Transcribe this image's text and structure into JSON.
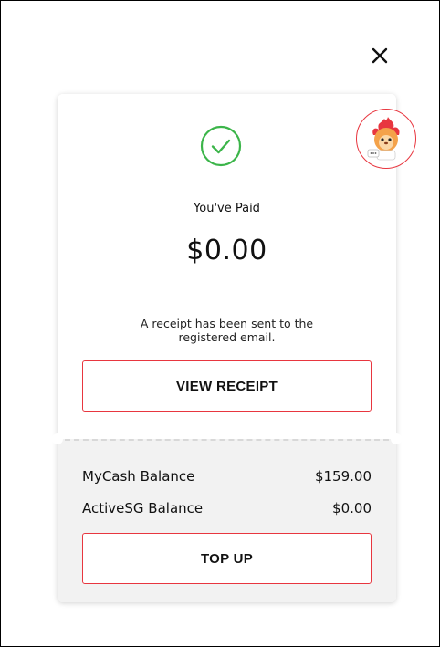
{
  "dialog": {
    "close_icon": "close-icon"
  },
  "payment": {
    "status_icon": "check-circle-icon",
    "status_label": "You've Paid",
    "amount": "$0.00",
    "receipt_note": "A receipt has been sent to the registered email.",
    "view_receipt_label": "VIEW RECEIPT"
  },
  "balances": {
    "items": [
      {
        "label": "MyCash Balance",
        "value": "$159.00"
      },
      {
        "label": "ActiveSG Balance",
        "value": "$0.00"
      }
    ],
    "top_up_label": "TOP UP"
  },
  "mascot": {
    "icon": "mascot-chat-icon"
  },
  "colors": {
    "accent": "#e8363f",
    "success": "#3cb54a",
    "balance_bg": "#f2f2f2"
  }
}
